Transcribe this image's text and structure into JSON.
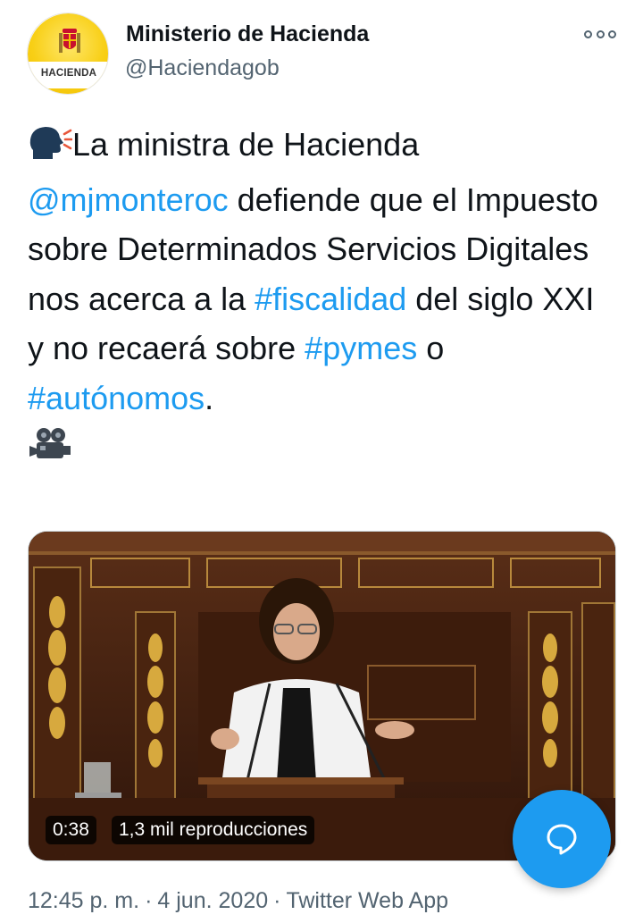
{
  "account": {
    "name": "Ministerio de Hacienda",
    "handle": "@Haciendagob",
    "avatar_text": "HACIENDA"
  },
  "tweet": {
    "emoji_speaking": "🗣",
    "text_1": "La ministra de Hacienda",
    "mention": "@mjmonteroc",
    "text_2": " defiende que el Impuesto sobre Determinados Servicios Digitales nos acerca a la ",
    "hashtag_1": "#fiscalidad",
    "text_3": " del siglo XXI  y no recaerá sobre ",
    "hashtag_2": "#pymes",
    "text_4": " o ",
    "hashtag_3": "#autónomos",
    "text_5": ".",
    "emoji_camera": "🎥"
  },
  "video": {
    "duration": "0:38",
    "views": "1,3 mil reproducciones"
  },
  "meta": {
    "time": "12:45 p. m.",
    "date": "4 jun. 2020",
    "source": "Twitter Web App",
    "separator": "·"
  },
  "colors": {
    "link": "#1d9bf0",
    "secondary_text": "#536471",
    "fab": "#1d9bf0"
  },
  "icons": {
    "more": "more-horizontal-icon",
    "compose": "reply-bubble-icon"
  }
}
